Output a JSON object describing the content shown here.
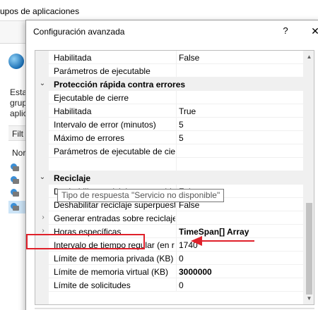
{
  "background_window": {
    "title": "upos de aplicaciones",
    "description_lines": [
      "Esta",
      "grup",
      "aplic"
    ],
    "filter_label": "Filt",
    "column_label": "Nor"
  },
  "dialog": {
    "title": "Configuración avanzada",
    "help_glyph": "?",
    "close_glyph": "✕"
  },
  "grid": {
    "rows": [
      {
        "type": "prop",
        "name": "Habilitada",
        "value": "False",
        "bold_value": false
      },
      {
        "type": "prop",
        "name": "Parámetros de ejecutable",
        "value": "",
        "bold_value": false
      },
      {
        "type": "cat",
        "name": "Protección rápida contra errores",
        "chevron": "⌄"
      },
      {
        "type": "prop",
        "name": "Ejecutable de cierre",
        "value": "",
        "bold_value": false
      },
      {
        "type": "prop",
        "name": "Habilitada",
        "value": "True",
        "bold_value": false
      },
      {
        "type": "prop",
        "name": "Intervalo de error (minutos)",
        "value": "5",
        "bold_value": false
      },
      {
        "type": "prop",
        "name": "Máximo de errores",
        "value": "5",
        "bold_value": false
      },
      {
        "type": "prop",
        "name": "Parámetros de ejecutable de cie",
        "value": "",
        "bold_value": false
      },
      {
        "type": "prop",
        "name": "",
        "value": "",
        "bold_value": false
      },
      {
        "type": "cat",
        "name": "Reciclaje",
        "chevron": "⌄"
      },
      {
        "type": "prop",
        "name": "Deshabilitar reciclaje por cambic",
        "value": "False",
        "bold_value": false
      },
      {
        "type": "prop",
        "name": "Deshabilitar reciclaje superpuest",
        "value": "False",
        "bold_value": false
      },
      {
        "type": "prop",
        "name": "Generar entradas sobre reciclaje",
        "value": "",
        "bold_value": false,
        "expander": "›"
      },
      {
        "type": "prop",
        "name": "Horas específicas",
        "value": "TimeSpan[] Array",
        "bold_value": true,
        "expander": "›"
      },
      {
        "type": "prop",
        "name": "Intervalo de tiempo regular (en r",
        "value": "1740",
        "bold_value": false
      },
      {
        "type": "prop",
        "name": "Límite de memoria privada (KB)",
        "value": "0",
        "bold_value": false
      },
      {
        "type": "prop",
        "name": "Límite de memoria virtual (KB)",
        "value": "3000000",
        "bold_value": true
      },
      {
        "type": "prop",
        "name": "Límite de solicitudes",
        "value": "0",
        "bold_value": false
      }
    ],
    "tooltip": "Tipo de respuesta \"Servicio no disponible\"",
    "scroll_up_glyph": "▲",
    "scroll_down_glyph": "▼"
  },
  "annotation": {
    "color": "#e0202a"
  }
}
